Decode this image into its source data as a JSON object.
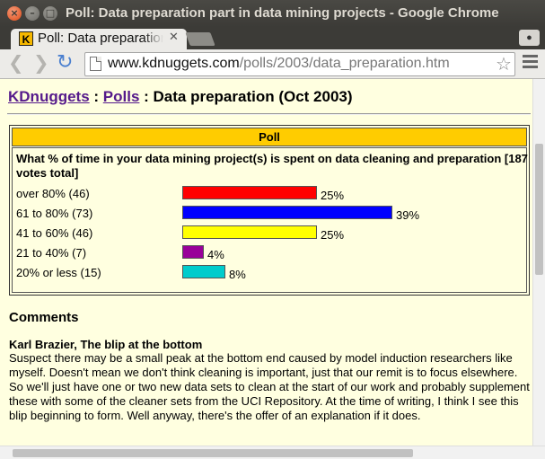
{
  "window": {
    "title": "Poll: Data preparation part in data mining projects - Google Chrome"
  },
  "tab": {
    "title": "Poll: Data preparation part in data mining projects",
    "favicon_letter": "K"
  },
  "toolbar": {
    "url_host": "www.kdnuggets.com",
    "url_path": "/polls/2003/data_preparation.htm",
    "icons": [
      "back-icon",
      "forward-icon",
      "reload-icon",
      "page-icon",
      "star-icon",
      "menu-icon"
    ]
  },
  "page": {
    "breadcrumb": {
      "home": "KDnuggets",
      "sep1": " : ",
      "polls": "Polls",
      "sep2": " : ",
      "current": "Data preparation (Oct 2003)"
    },
    "poll": {
      "header": "Poll",
      "question": "What % of time in your data mining project(s) is spent on data cleaning and preparation [187 votes total]",
      "options": [
        {
          "label": "over 80% (46)",
          "percent_text": "25%",
          "percent": 25,
          "color": "#ff0000"
        },
        {
          "label": "61 to 80% (73)",
          "percent_text": "39%",
          "percent": 39,
          "color": "#0000ff"
        },
        {
          "label": "41 to 60% (46)",
          "percent_text": "25%",
          "percent": 25,
          "color": "#ffff00"
        },
        {
          "label": "21 to 40% (7)",
          "percent_text": "4%",
          "percent": 4,
          "color": "#990099"
        },
        {
          "label": "20% or less (15)",
          "percent_text": "8%",
          "percent": 8,
          "color": "#00cccc"
        }
      ]
    },
    "comments": {
      "heading": "Comments",
      "items": [
        {
          "author": "Karl Brazier, The blip at the bottom",
          "body": "Suspect there may be a small peak at the bottom end caused by model induction researchers like myself. Doesn't mean we don't think cleaning is important, just that our remit is to focus elsewhere. So we'll just have one or two new data sets to clean at the start of our work and probably supplement these with some of the cleaner sets from the UCI Repository. At the time of writing, I think I see this blip beginning to form. Well anyway, there's the offer of an explanation if it does."
        }
      ]
    }
  }
}
